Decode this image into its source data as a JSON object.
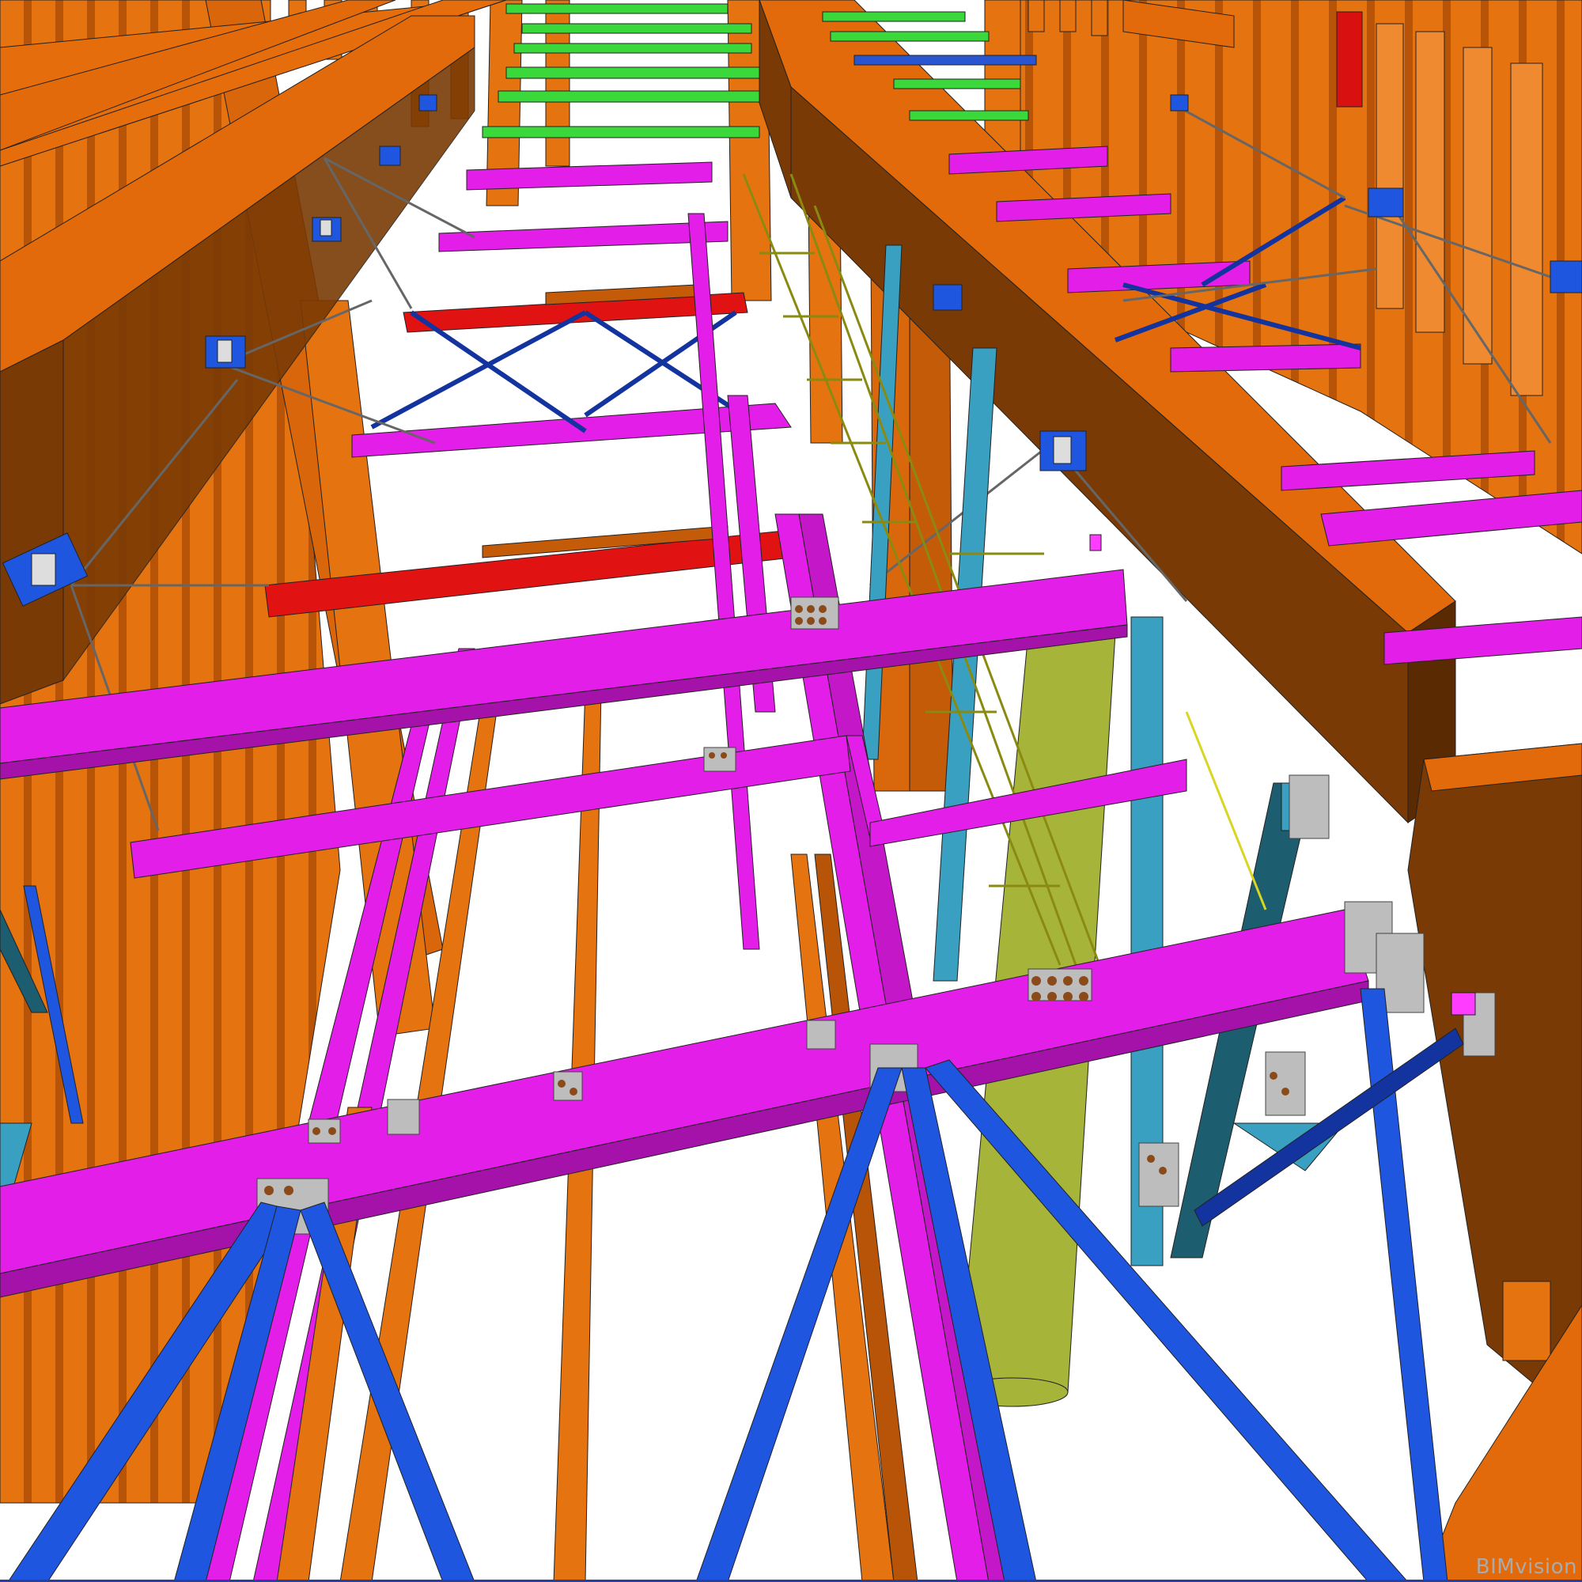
{
  "viewer": {
    "watermark": "BIMvision"
  },
  "colors": {
    "background": "#ffffff",
    "waler_orange": "#e06a0a",
    "waler_shade": "#7a3a05",
    "pile_orange": "#e5730f",
    "pile_dark": "#b85407",
    "strut_magenta": "#e31ee8",
    "strut_magenta_dark": "#a512aa",
    "brace_blue": "#1e56e0",
    "brace_navy": "#13339e",
    "kingpost_teal": "#3aa0c2",
    "kingpost_dark": "#1d5d70",
    "walkway_yellow": "#e8e63a",
    "beam_red": "#e01212",
    "beam_green": "#3ad83a",
    "column_olive": "#a7b43a",
    "plate_grey": "#bdbdbd",
    "bolt_brown": "#8a4a1a",
    "outline": "#222222"
  }
}
